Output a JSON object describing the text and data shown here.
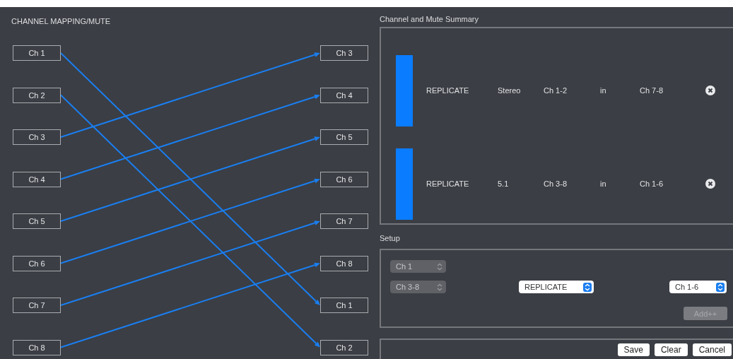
{
  "mapping": {
    "title": "CHANNEL MAPPING/MUTE",
    "inputs": [
      "Ch 1",
      "Ch 2",
      "Ch 3",
      "Ch 4",
      "Ch 5",
      "Ch 6",
      "Ch 7",
      "Ch 8"
    ],
    "outputs": [
      "Ch 3",
      "Ch 4",
      "Ch 5",
      "Ch 6",
      "Ch 7",
      "Ch 8",
      "Ch 1",
      "Ch 2"
    ]
  },
  "summary": {
    "title": "Channel and Mute Summary",
    "rows": [
      {
        "mode": "REPLICATE",
        "format": "Stereo",
        "source": "Ch 1-2",
        "preposition": "in",
        "target": "Ch 7-8"
      },
      {
        "mode": "REPLICATE",
        "format": "5.1",
        "source": "Ch 3-8",
        "preposition": "in",
        "target": "Ch 1-6"
      }
    ]
  },
  "setup": {
    "title": "Setup",
    "source_select": {
      "value": "Ch 1",
      "disabled": true
    },
    "range_select": {
      "value": "Ch 3-8",
      "disabled": true
    },
    "mode_select": {
      "value": "REPLICATE",
      "disabled": false
    },
    "target_select": {
      "value": "Ch 1-6",
      "disabled": false
    },
    "add_button": {
      "label": "Add++",
      "disabled": true
    }
  },
  "footer_buttons": [
    "Save",
    "Clear",
    "Cancel"
  ]
}
